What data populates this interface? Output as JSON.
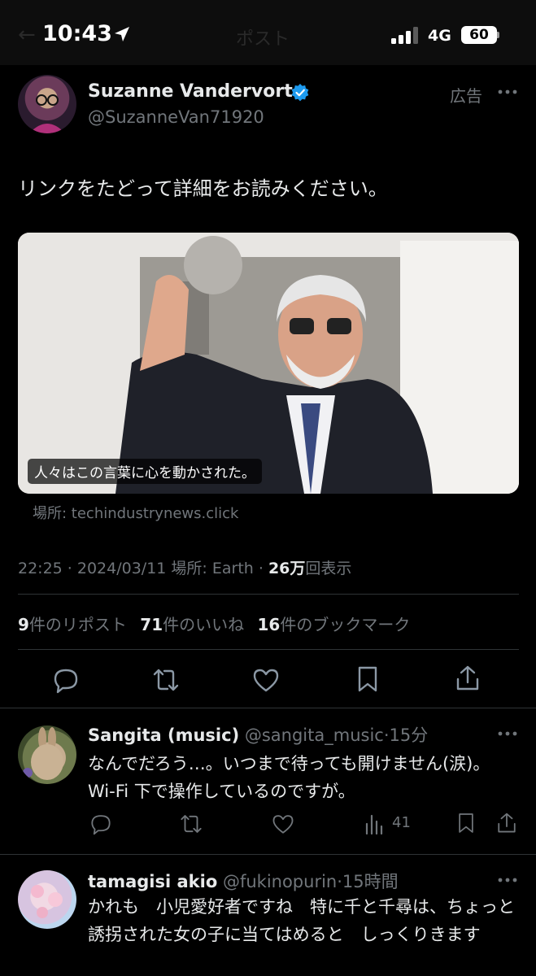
{
  "status_bar": {
    "time": "10:43",
    "network": "4G",
    "battery": "60",
    "ghost_title": "ポスト"
  },
  "post": {
    "author_name": "Suzanne Vandervort",
    "author_handle": "@SuzanneVan71920",
    "ad_label": "広告",
    "text": "リンクをたどって詳細をお読みください。",
    "image_caption": "人々はこの言葉に心を動かされた。",
    "link_source": "場所: techindustrynews.click",
    "meta_time": "22:25 · 2024/03/11 場所: Earth · ",
    "meta_views_count": "26万",
    "meta_views_label": "回表示",
    "stats": {
      "reposts_count": "9",
      "reposts_label": "件のリポスト",
      "likes_count": "71",
      "likes_label": "件のいいね",
      "bookmarks_count": "16",
      "bookmarks_label": "件のブックマーク"
    }
  },
  "replies": [
    {
      "name": "Sangita (music)",
      "handle": "@sangita_music",
      "time": "·15分",
      "text": "なんでだろう…。いつまで待っても開けません(涙)。Wi-Fi 下で操作しているのですが。",
      "views": "41"
    },
    {
      "name": "tamagisi akio",
      "handle": "@fukinopurin",
      "time": "·15時間",
      "text": "かれも　小児愛好者ですね　特に千と千尋は、ちょっと誘拐された女の子に当てはめると　しっくりきます"
    }
  ],
  "colors": {
    "verified": "#1d9bf0",
    "muted": "#71767b",
    "background": "#000000"
  }
}
